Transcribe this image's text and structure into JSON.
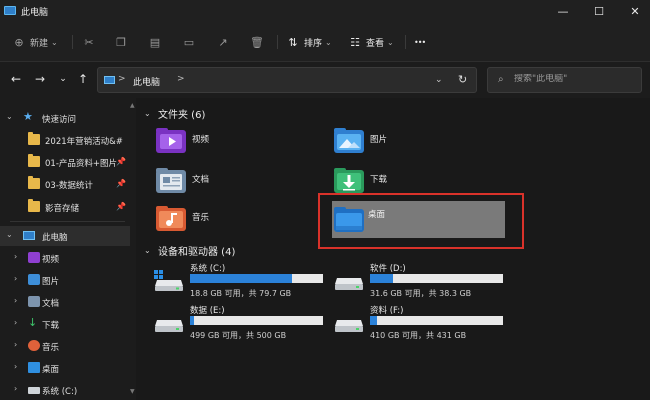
{
  "window": {
    "title": "此电脑",
    "minimize_glyph": "—",
    "maximize_glyph": "☐",
    "close_glyph": "✕"
  },
  "toolbar": {
    "new_label": "新建",
    "sort_label": "排序",
    "view_label": "查看",
    "more_glyph": "•••"
  },
  "address": {
    "chevron": ">",
    "location": "此电脑",
    "search_placeholder": "搜索\"此电脑\""
  },
  "sidebar": {
    "quick_access": "快速访问",
    "pinned": [
      {
        "label": "2021年营销活动&#"
      },
      {
        "label": "01-产品资料+图片"
      },
      {
        "label": "03-数据统计"
      },
      {
        "label": "影音存储"
      }
    ],
    "this_pc": "此电脑",
    "pc_items": [
      {
        "label": "视频"
      },
      {
        "label": "图片"
      },
      {
        "label": "文档"
      },
      {
        "label": "下载"
      },
      {
        "label": "音乐"
      },
      {
        "label": "桌面"
      },
      {
        "label": "系统 (C:)"
      }
    ]
  },
  "folders_section": {
    "title": "文件夹 (6)",
    "items": [
      {
        "label": "视频",
        "icon": "video-folder-icon"
      },
      {
        "label": "图片",
        "icon": "pictures-folder-icon"
      },
      {
        "label": "文档",
        "icon": "documents-folder-icon"
      },
      {
        "label": "下载",
        "icon": "downloads-folder-icon"
      },
      {
        "label": "音乐",
        "icon": "music-folder-icon"
      },
      {
        "label": "桌面",
        "icon": "desktop-folder-icon"
      }
    ]
  },
  "drives_section": {
    "title": "设备和驱动器 (4)",
    "drives": [
      {
        "name": "系统 (C:)",
        "info": "18.8 GB 可用，共 79.7 GB",
        "used_fraction": 0.764
      },
      {
        "name": "软件 (D:)",
        "info": "31.6 GB 可用，共 38.3 GB",
        "used_fraction": 0.175
      },
      {
        "name": "数据 (E:)",
        "info": "499 GB 可用，共 500 GB",
        "used_fraction": 0.002
      },
      {
        "name": "资料 (F:)",
        "info": "410 GB 可用，共 431 GB",
        "used_fraction": 0.049
      }
    ]
  },
  "colors": {
    "accent": "#2b82d9",
    "highlight_border": "#d9322a",
    "selected_tile": "#7a7a7a"
  }
}
